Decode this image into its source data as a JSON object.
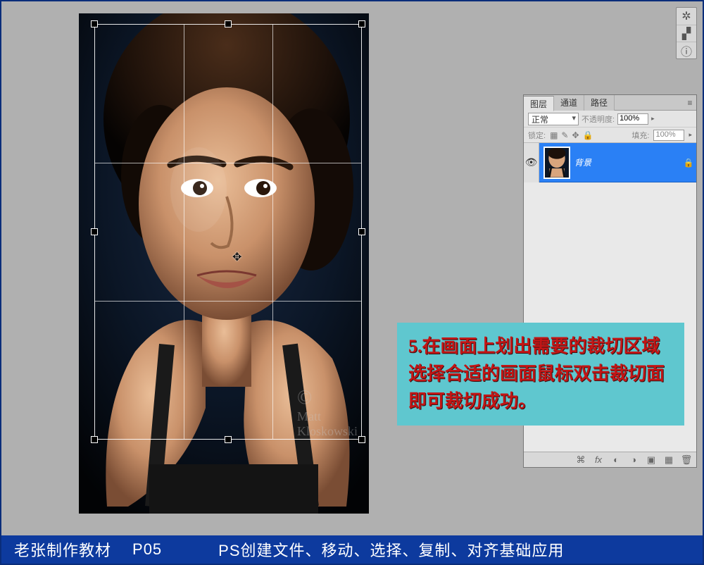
{
  "miniPalette": {
    "icons": [
      "gear",
      "histogram",
      "info"
    ]
  },
  "panel": {
    "tabs": [
      "图层",
      "通道",
      "路径"
    ],
    "activeTab": 0,
    "blendMode": "正常",
    "opacityLabel": "不透明度:",
    "opacityValue": "100%",
    "lockLabel": "锁定:",
    "fillLabel": "填充:",
    "fillValue": "100%",
    "layer": {
      "name": "背景",
      "visible": true,
      "locked": true
    },
    "footIcons": [
      "link",
      "fx",
      "mask",
      "adjust",
      "folder",
      "new",
      "trash"
    ]
  },
  "callout": {
    "text": "5.在画面上划出需要的裁切区域选择合适的画面鼠标双击裁切面即可裁切成功。"
  },
  "bottom": {
    "left": "老张制作教材",
    "page": "P05",
    "right": "PS创建文件、移动、选择、复制、对齐基础应用"
  },
  "watermark": {
    "copyright": "©",
    "name": "Matt Kloskowski"
  }
}
